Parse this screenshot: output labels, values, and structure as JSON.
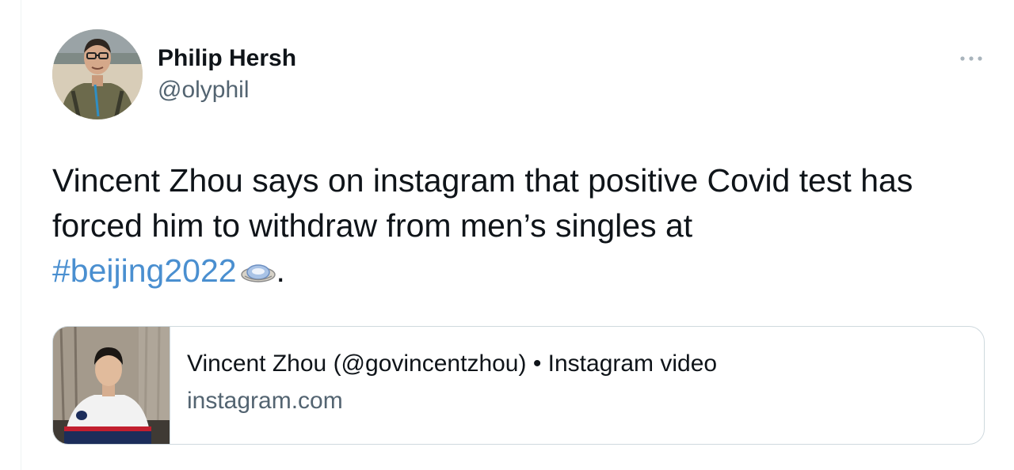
{
  "author": {
    "name": "Philip Hersh",
    "handle": "@olyphil"
  },
  "tweet": {
    "text_line1": "Vincent Zhou says on instagram that positive Covid test has",
    "text_line2": "forced him to withdraw from men’s singles at",
    "hashtag": "#beijing2022",
    "trailing": "."
  },
  "card": {
    "title": "Vincent Zhou (@govincentzhou) • Instagram video",
    "domain": "instagram.com"
  },
  "icons": {
    "more": "more-options-icon",
    "hashflag": "olympics-hashflag-icon"
  },
  "colors": {
    "text": "#0f1419",
    "secondary": "#536471",
    "link": "#4a8fd0",
    "border": "#cfd9de"
  }
}
